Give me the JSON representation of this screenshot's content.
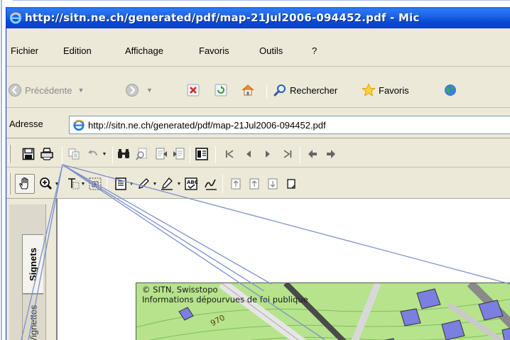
{
  "window": {
    "title": "http://sitn.ne.ch/generated/pdf/map-21Jul2006-094452.pdf - Mic"
  },
  "menubar": {
    "items": [
      "Fichier",
      "Edition",
      "Affichage",
      "Favoris",
      "Outils",
      "?"
    ]
  },
  "navbar": {
    "back_label": "Précédente",
    "search_label": "Rechercher",
    "favorites_label": "Favoris"
  },
  "address": {
    "label": "Adresse",
    "value": "http://sitn.ne.ch/generated/pdf/map-21Jul2006-094452.pdf"
  },
  "side_panel": {
    "tab_bookmarks": "Signets",
    "tab_thumbnails": "Vignettes"
  },
  "map": {
    "copyright": "© SITN, Swisstopo",
    "disclaimer": "Informations dépourvues de foi publique",
    "label_contour": "970"
  },
  "colors": {
    "titlebar": "#0a49d4",
    "chrome": "#ece9d8",
    "map_green": "#b6e38c",
    "map_building": "#7b7fe0",
    "annotation_line": "#7b8fcf"
  }
}
